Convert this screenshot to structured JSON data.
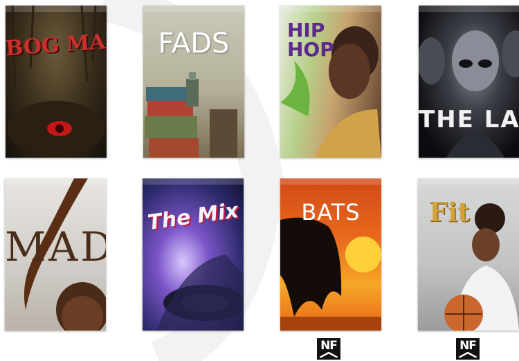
{
  "covers": [
    {
      "title": "BOG MAN"
    },
    {
      "title": "FADS"
    },
    {
      "title": "HIP HOP"
    },
    {
      "title": "THE LAB"
    },
    {
      "title": "MAD"
    },
    {
      "title": "The Mix"
    },
    {
      "title": "BATS"
    },
    {
      "title": "Fit"
    }
  ],
  "badges": [
    {
      "label": "NF"
    },
    {
      "label": "NF"
    }
  ]
}
